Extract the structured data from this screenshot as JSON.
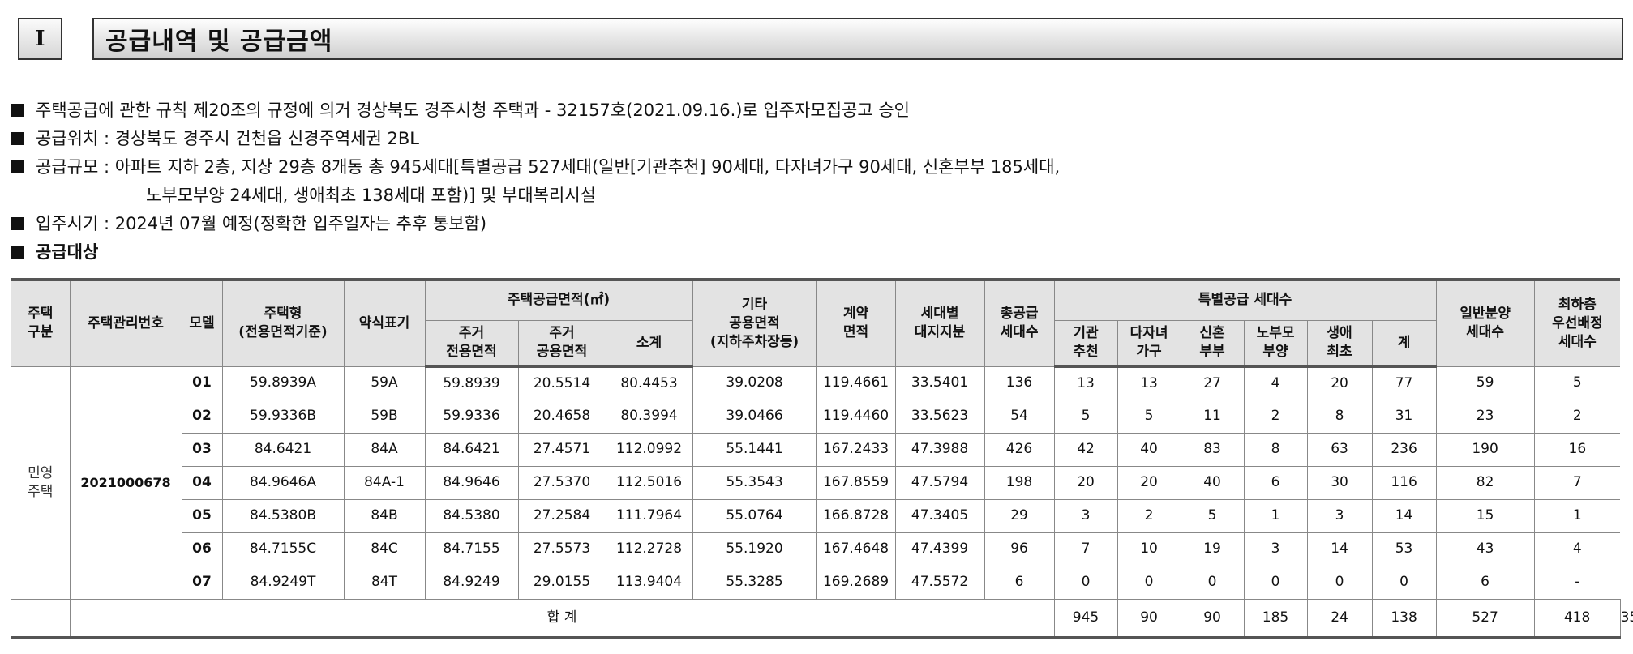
{
  "section": {
    "number": "I",
    "title": "공급내역 및 공급금액"
  },
  "bullets": {
    "line1": "주택공급에 관한 규칙 제20조의 규정에 의거 경상북도 경주시청 주택과 - 32157호(2021.09.16.)로 입주자모집공고 승인",
    "line2": "공급위치 : 경상북도 경주시 건천읍 신경주역세권 2BL",
    "line3a": "공급규모 : 아파트 지하 2층, 지상 29층 8개동 총 945세대[특별공급 527세대(일반[기관추천] 90세대, 다자녀가구 90세대, 신혼부부 185세대,",
    "line3b": "노부모부양 24세대, 생애최초 138세대 포함)] 및 부대복리시설",
    "line4": "입주시기 : 2024년 07월 예정(정확한 입주일자는 추후 통보함)",
    "heading": "공급대상"
  },
  "table": {
    "headers": {
      "type": "주택\n구분",
      "mgmt_no": "주택관리번호",
      "model": "모델",
      "house_type": "주택형\n(전용면적기준)",
      "abbr": "약식표기",
      "supply_area": "주택공급면적(㎡)",
      "excl": "주거\n전용면적",
      "common": "주거\n공용면적",
      "subtotal": "소계",
      "other_common": "기타\n공용면적\n(지하주차장등)",
      "contract": "계약\n면적",
      "land": "세대별\n대지지분",
      "total_units": "총공급\n세대수",
      "special": "특별공급 세대수",
      "agency": "기관\n추천",
      "multi_child": "다자녀\n가구",
      "newlywed": "신혼\n부부",
      "elderly": "노부모\n부양",
      "first_life": "생애\n최초",
      "sp_total": "계",
      "general": "일반분양\n세대수",
      "lowest_floor": "최하층\n우선배정\n세대수"
    },
    "house_category": "민영\n주택",
    "mgmt_number": "2021000678",
    "rows": [
      [
        "01",
        "59.8939A",
        "59A",
        "59.8939",
        "20.5514",
        "80.4453",
        "39.0208",
        "119.4661",
        "33.5401",
        "136",
        "13",
        "13",
        "27",
        "4",
        "20",
        "77",
        "59",
        "5"
      ],
      [
        "02",
        "59.9336B",
        "59B",
        "59.9336",
        "20.4658",
        "80.3994",
        "39.0466",
        "119.4460",
        "33.5623",
        "54",
        "5",
        "5",
        "11",
        "2",
        "8",
        "31",
        "23",
        "2"
      ],
      [
        "03",
        "84.6421",
        "84A",
        "84.6421",
        "27.4571",
        "112.0992",
        "55.1441",
        "167.2433",
        "47.3988",
        "426",
        "42",
        "40",
        "83",
        "8",
        "63",
        "236",
        "190",
        "16"
      ],
      [
        "04",
        "84.9646A",
        "84A-1",
        "84.9646",
        "27.5370",
        "112.5016",
        "55.3543",
        "167.8559",
        "47.5794",
        "198",
        "20",
        "20",
        "40",
        "6",
        "30",
        "116",
        "82",
        "7"
      ],
      [
        "05",
        "84.5380B",
        "84B",
        "84.5380",
        "27.2584",
        "111.7964",
        "55.0764",
        "166.8728",
        "47.3405",
        "29",
        "3",
        "2",
        "5",
        "1",
        "3",
        "14",
        "15",
        "1"
      ],
      [
        "06",
        "84.7155C",
        "84C",
        "84.7155",
        "27.5573",
        "112.2728",
        "55.1920",
        "167.4648",
        "47.4399",
        "96",
        "7",
        "10",
        "19",
        "3",
        "14",
        "53",
        "43",
        "4"
      ],
      [
        "07",
        "84.9249T",
        "84T",
        "84.9249",
        "29.0155",
        "113.9404",
        "55.3285",
        "169.2689",
        "47.5572",
        "6",
        "0",
        "0",
        "0",
        "0",
        "0",
        "0",
        "6",
        "-"
      ]
    ],
    "total": {
      "label": "합 계",
      "values": [
        "945",
        "90",
        "90",
        "185",
        "24",
        "138",
        "527",
        "418",
        "35"
      ]
    }
  }
}
